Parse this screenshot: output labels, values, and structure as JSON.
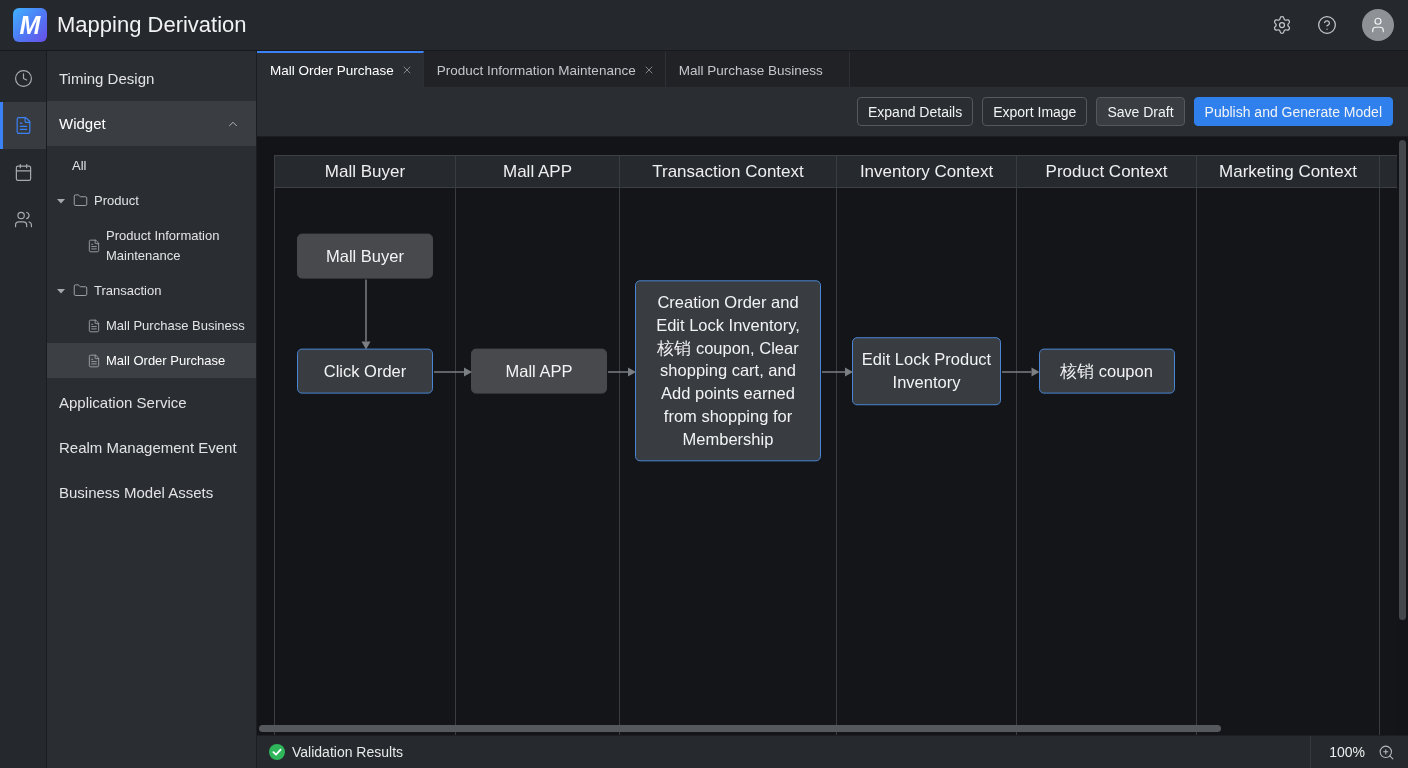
{
  "header": {
    "logo_letter": "M",
    "title": "Mapping Derivation"
  },
  "rail": [
    {
      "selected": false
    },
    {
      "selected": true
    },
    {
      "selected": false
    },
    {
      "selected": false
    }
  ],
  "nav": [
    {
      "label": "Timing Design",
      "selected": false
    },
    {
      "label": "Widget",
      "selected": true,
      "expanded": true,
      "tree": [
        {
          "kind": "all",
          "label": "All",
          "selected": false
        },
        {
          "kind": "folder",
          "label": "Product",
          "selected": false,
          "expanded": true,
          "children": [
            {
              "kind": "file",
              "label": "Product Information Maintenance",
              "selected": false
            }
          ]
        },
        {
          "kind": "folder",
          "label": "Transaction",
          "selected": false,
          "expanded": true,
          "children": [
            {
              "kind": "file",
              "label": "Mall Purchase Business",
              "selected": false
            },
            {
              "kind": "file",
              "label": "Mall Order Purchase",
              "selected": true
            }
          ]
        }
      ]
    },
    {
      "label": "Application Service",
      "selected": false
    },
    {
      "label": "Realm Management Event",
      "selected": false
    },
    {
      "label": "Business Model Assets",
      "selected": false
    }
  ],
  "tabs": [
    {
      "label": "Mall Order Purchase",
      "selected": true,
      "closable": true
    },
    {
      "label": "Product Information Maintenance",
      "selected": false,
      "closable": true
    },
    {
      "label": "Mall Purchase Business",
      "selected": false,
      "closable": false
    }
  ],
  "toolbar": {
    "buttons": [
      {
        "label": "Expand Details",
        "kind": "outline"
      },
      {
        "label": "Export Image",
        "kind": "outline"
      },
      {
        "label": "Save Draft",
        "kind": "filled"
      },
      {
        "label": "Publish and Generate Model",
        "kind": "primary"
      }
    ]
  },
  "diagram": {
    "lanes": [
      {
        "title": "Mall Buyer",
        "nodes": [
          {
            "label": "Mall Buyer",
            "kind": "participant"
          },
          {
            "label": "Click Order",
            "kind": "action"
          }
        ]
      },
      {
        "title": "Mall APP",
        "nodes": [
          {
            "label": "Mall APP",
            "kind": "participant"
          }
        ]
      },
      {
        "title": "Transaction Context",
        "nodes": [
          {
            "label": "Creation Order and Edit Lock Inventory, 核销 coupon, Clear shopping cart, and Add points earned from shopping for Membership",
            "kind": "action"
          }
        ]
      },
      {
        "title": "Inventory Context",
        "nodes": [
          {
            "label": "Edit Lock Product Inventory",
            "kind": "action"
          }
        ]
      },
      {
        "title": "Product Context",
        "nodes": [
          {
            "label": "核销 coupon",
            "kind": "action"
          }
        ]
      },
      {
        "title": "Marketing Context"
      }
    ]
  },
  "status_bar": {
    "validation": {
      "label": "Validation Results",
      "passed": true
    },
    "zoom": "100%"
  }
}
